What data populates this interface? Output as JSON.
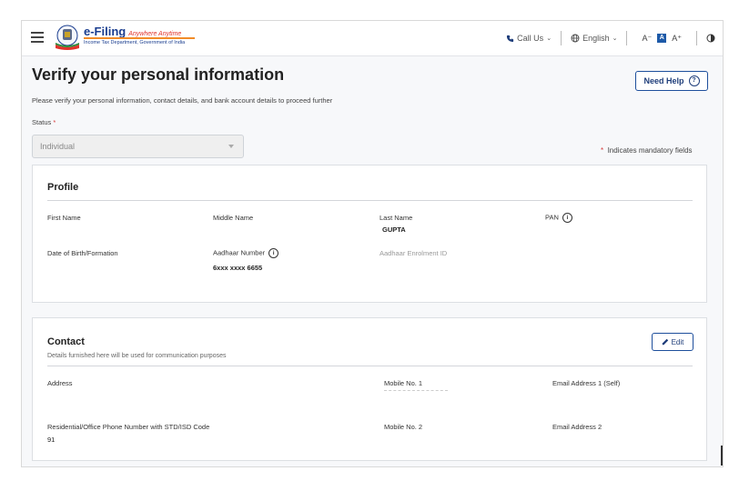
{
  "header": {
    "logo_title": "e-Filing",
    "logo_tagline": "Anywhere Anytime",
    "logo_subtitle": "Income Tax Department, Government of India",
    "call_us": "Call Us",
    "language": "English",
    "font_decrease": "A⁻",
    "font_normal": "A",
    "font_increase": "A⁺"
  },
  "page": {
    "title": "Verify your personal information",
    "subtitle": "Please verify your personal information, contact details, and bank account details to proceed further",
    "need_help": "Need Help",
    "status_label": "Status",
    "status_value": "Individual",
    "mandatory_note": "Indicates mandatory fields"
  },
  "profile": {
    "title": "Profile",
    "first_name_label": "First Name",
    "middle_name_label": "Middle Name",
    "last_name_label": "Last Name",
    "last_name_value": "GUPTA",
    "pan_label": "PAN",
    "dob_label": "Date of Birth/Formation",
    "aadhaar_label": "Aadhaar Number",
    "aadhaar_value": "6xxx xxxx 6655",
    "enrolment_label": "Aadhaar Enrolment ID"
  },
  "contact": {
    "title": "Contact",
    "description": "Details furnished here will be used for communication purposes",
    "edit_label": "Edit",
    "address_label": "Address",
    "mobile1_label": "Mobile No. 1",
    "email1_label": "Email Address 1 (Self)",
    "phone_label": "Residential/Office Phone Number with STD/ISD Code",
    "phone_value": "91",
    "mobile2_label": "Mobile No. 2",
    "email2_label": "Email Address 2"
  },
  "colors": {
    "brand_blue": "#1e3d7a",
    "required_red": "#d63b3b"
  }
}
